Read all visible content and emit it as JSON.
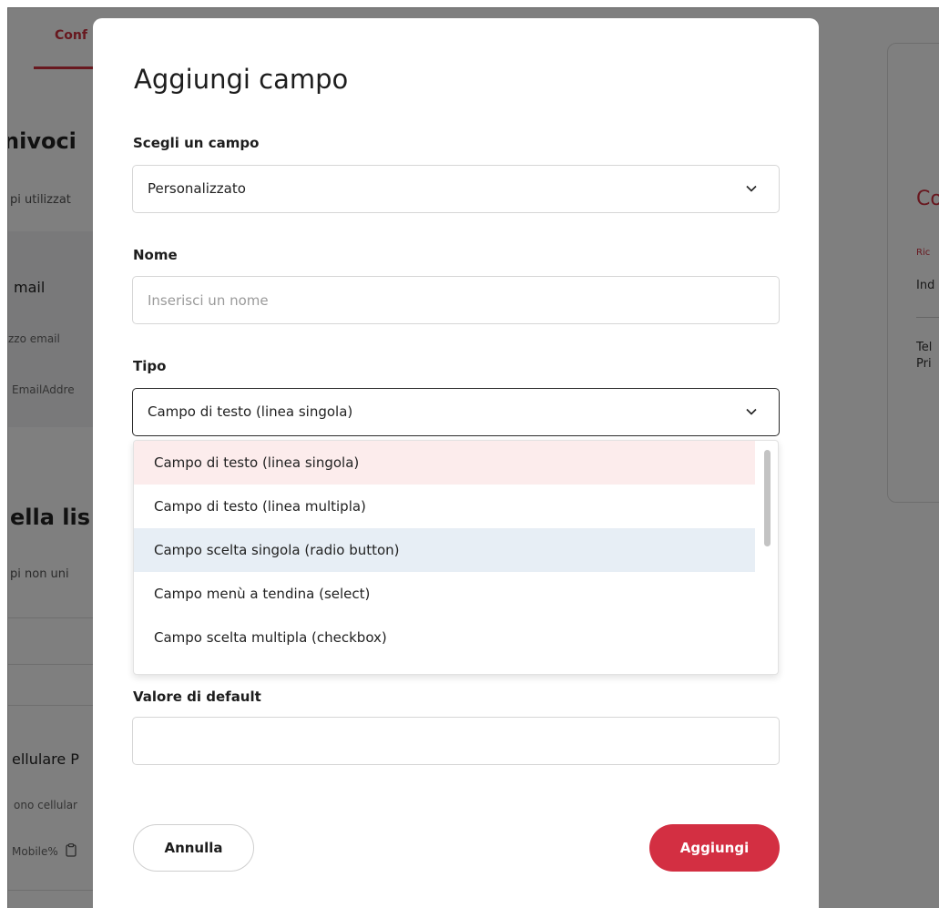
{
  "background": {
    "tab_label": "Conf",
    "section1_title": "nivoci",
    "section1_subtitle": "pi utilizzat",
    "card_title": "mail",
    "card_line1": "zzo email",
    "card_line2": "EmailAddre",
    "section2_title": "ella lis",
    "section2_subtitle": "pi non uni",
    "field_title": "ellulare P",
    "field_line1": "ono cellular",
    "field_line2": "Mobile%",
    "panel_title": "Co",
    "panel_small": "Ric",
    "panel_line1": "Ind",
    "panel_line2": "Tel",
    "panel_line3": "Pri"
  },
  "modal": {
    "title": "Aggiungi campo",
    "field_choice": {
      "label": "Scegli un campo",
      "value": "Personalizzato"
    },
    "name": {
      "label": "Nome",
      "placeholder": "Inserisci un nome",
      "value": ""
    },
    "type": {
      "label": "Tipo",
      "value": "Campo di testo (linea singola)",
      "options": [
        "Campo di testo (linea singola)",
        "Campo di testo (linea multipla)",
        "Campo scelta singola (radio button)",
        "Campo menù a tendina (select)",
        "Campo scelta multipla (checkbox)"
      ],
      "selected_index": 0,
      "hover_index": 2
    },
    "default_value": {
      "label": "Valore di default",
      "value": ""
    },
    "cancel_label": "Annulla",
    "add_label": "Aggiungi"
  },
  "colors": {
    "accent": "#d32f42",
    "selected_option_bg": "#fcecec",
    "hover_option_bg": "#e7eef5",
    "overlay": "rgba(0,0,0,0.5)"
  },
  "icons": {
    "chevron": "chevron-down-icon",
    "clipboard": "clipboard-icon"
  }
}
